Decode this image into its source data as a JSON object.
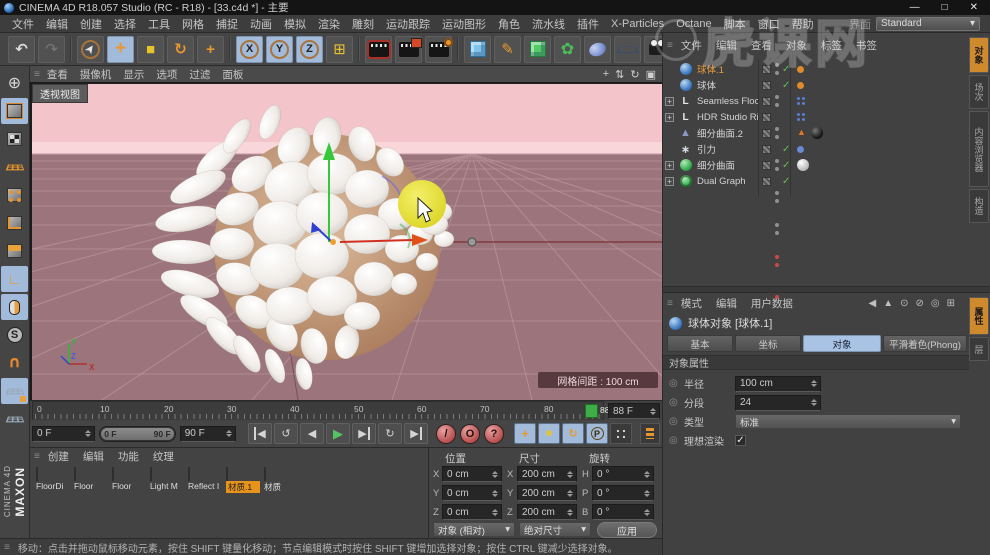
{
  "window": {
    "title": "CINEMA 4D R18.057 Studio (RC - R18) - [33.c4d *] - 主要",
    "minimize": "—",
    "maximize": "□",
    "close": "✕"
  },
  "icons": {
    "grip": "≡",
    "caret_down": "▾",
    "check": "✓",
    "undo": "↶",
    "redo": "↷",
    "pointer": "➤",
    "plus": "+",
    "square": "■",
    "rot_cw": "↻",
    "rot_ccw": "↺",
    "axis_x": "X",
    "axis_y": "Y",
    "axis_z": "Z",
    "pen": "✎",
    "flower": "✿",
    "globe": "⊕",
    "prev": "◀",
    "play": "▶",
    "next": "▶",
    "question": "?",
    "slash": "/",
    "ring": "O",
    "letter_p": "P",
    "letter_s": "S",
    "letter_l": "L",
    "letter_o": "o",
    "attr_dot": "◎",
    "back": "◀",
    "up_tri": "▲",
    "search": "⊙",
    "lock": "⊘",
    "target": "◎",
    "popout": "⊞",
    "expand": "+",
    "nav_zoom": "⇅",
    "nav_max": "▣",
    "magnet": "∪",
    "corner": "∟",
    "tri": "▲",
    "star": "∗"
  },
  "menu_bar": {
    "items": [
      "文件",
      "编辑",
      "创建",
      "选择",
      "工具",
      "网格",
      "捕捉",
      "动画",
      "模拟",
      "渲染",
      "雕刻",
      "运动跟踪",
      "运动图形",
      "角色",
      "流水线",
      "插件",
      "X-Particles",
      "Octane",
      "脚本",
      "窗口",
      "帮助"
    ],
    "layout_label": "界面",
    "layout_value": "Standard"
  },
  "viewport": {
    "menu": [
      "查看",
      "摄像机",
      "显示",
      "选项",
      "过滤",
      "面板"
    ],
    "view_label": "透视视图",
    "grid_spacing_label": "网格间距 : 100 cm",
    "axis_labels": {
      "x": "X",
      "y": "Y",
      "z": "Z"
    }
  },
  "object_manager": {
    "menu": [
      "文件",
      "编辑",
      "查看",
      "对象",
      "标签",
      "书签"
    ],
    "items": [
      {
        "name": "球体.1"
      },
      {
        "name": "球体"
      },
      {
        "name": "Seamless Floor"
      },
      {
        "name": "HDR Studio Rig"
      },
      {
        "name": "细分曲面.2"
      },
      {
        "name": "引力"
      },
      {
        "name": "细分曲面"
      },
      {
        "name": "Dual Graph"
      }
    ],
    "side_tabs": [
      "对象",
      "场次",
      "内容浏览器",
      "构造"
    ]
  },
  "attributes": {
    "menu": [
      "模式",
      "编辑",
      "用户数据"
    ],
    "title": "球体对象 [球体.1]",
    "tabs": [
      "基本",
      "坐标",
      "对象",
      "平滑着色(Phong)"
    ],
    "active_tab": "对象",
    "section": "对象属性",
    "radius_label": "半径",
    "radius_value": "100 cm",
    "segments_label": "分段",
    "segments_value": "24",
    "type_label": "类型",
    "type_value": "标准",
    "render_perfect_label": "理想渲染",
    "side_tabs": [
      "属性",
      "层"
    ]
  },
  "timeline": {
    "ticks": [
      "0",
      "10",
      "20",
      "30",
      "40",
      "50",
      "60",
      "70",
      "80"
    ],
    "playhead_label": "88",
    "current_frame": "88 F",
    "start_field": "0 F",
    "range_start": "0 F",
    "range_end": "90 F",
    "end_field": "90 F"
  },
  "materials": {
    "menu": [
      "创建",
      "编辑",
      "功能",
      "纹理"
    ],
    "items": [
      {
        "name": "FloorDi"
      },
      {
        "name": "Floor"
      },
      {
        "name": "Floor"
      },
      {
        "name": "Light M"
      },
      {
        "name": "Reflect I"
      },
      {
        "name": "材质.1"
      },
      {
        "name": "材质"
      }
    ]
  },
  "coordinates": {
    "headers": [
      "位置",
      "尺寸",
      "旋转"
    ],
    "labels": {
      "x": "X",
      "y": "Y",
      "z": "Z",
      "h": "H",
      "p": "P",
      "b": "B"
    },
    "pos": {
      "x": "0 cm",
      "y": "0 cm",
      "z": "0 cm"
    },
    "size": {
      "x": "200 cm",
      "y": "200 cm",
      "z": "200 cm"
    },
    "rot": {
      "h": "0 °",
      "p": "0 °",
      "b": "0 °"
    },
    "pos_mode": "对象 (相对)",
    "size_mode": "绝对尺寸",
    "apply_label": "应用"
  },
  "status_bar": {
    "text": "移动：点击并拖动鼠标移动元素，按住 SHIFT 键量化移动；节点编辑模式时按住 SHIFT 键增加选择对象；按住 CTRL 键减少选择对象。"
  },
  "branding": {
    "maxon": "MAXON",
    "cinema": "CINEMA 4D",
    "watermark": "虎课网"
  }
}
